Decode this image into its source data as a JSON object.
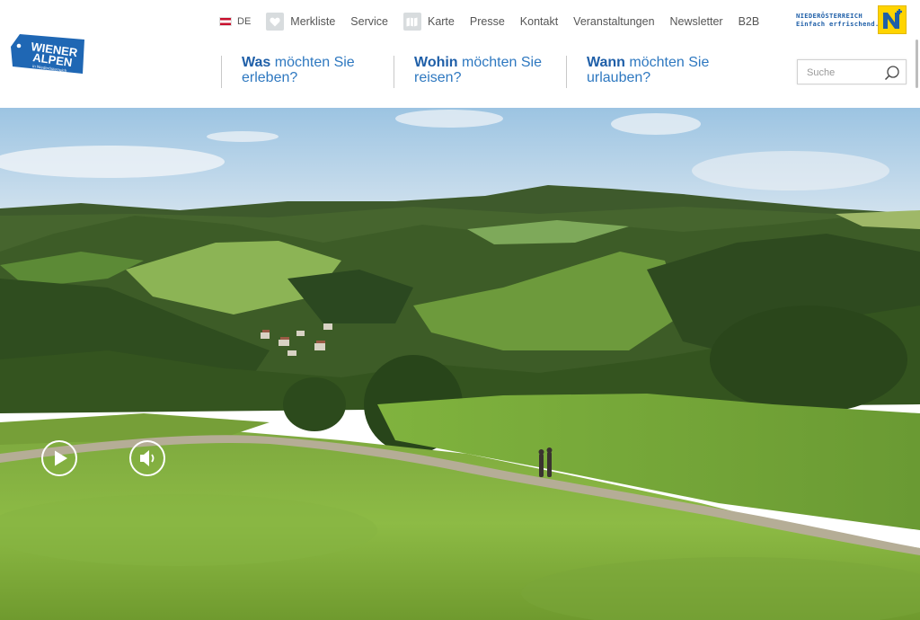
{
  "brand": {
    "logo_text": [
      "WIENER",
      "ALPEN"
    ],
    "logo_sub": "in Niederösterreich",
    "partner_lines": [
      "NIEDERÖSTERREICH",
      "Einfach erfrischend."
    ],
    "colors": {
      "primary": "#1f5fa8",
      "accent": "#ffd400",
      "austria_red": "#c8102e"
    }
  },
  "topnav": {
    "language": "DE",
    "items": [
      {
        "label": "Merkliste",
        "icon": "heart-icon"
      },
      {
        "label": "Service"
      },
      {
        "label": "Karte",
        "icon": "map-icon"
      },
      {
        "label": "Presse"
      },
      {
        "label": "Kontakt"
      },
      {
        "label": "Veranstaltungen"
      },
      {
        "label": "Newsletter"
      },
      {
        "label": "B2B"
      }
    ]
  },
  "mainnav": [
    {
      "bold": "Was",
      "rest": " möchten Sie",
      "line2": "erleben?"
    },
    {
      "bold": "Wohin",
      "rest": " möchten Sie",
      "line2": "reisen?"
    },
    {
      "bold": "Wann",
      "rest": " möchten Sie",
      "line2": "urlauben?"
    }
  ],
  "search": {
    "placeholder": "Suche",
    "value": ""
  },
  "hero": {
    "controls": [
      {
        "name": "play",
        "icon": "play-icon"
      },
      {
        "name": "sound",
        "icon": "speaker-icon"
      }
    ]
  }
}
